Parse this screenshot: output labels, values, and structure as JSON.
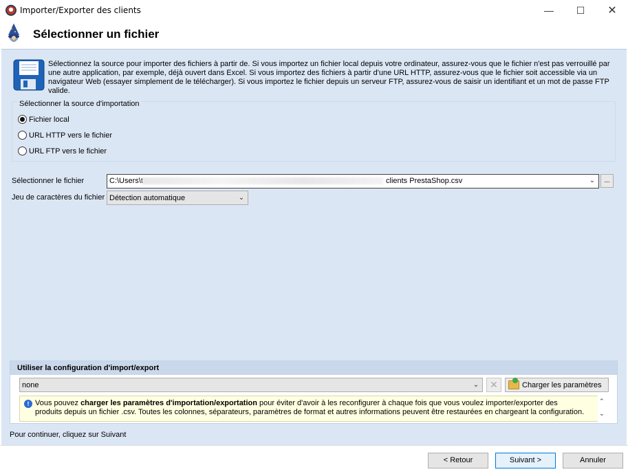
{
  "window": {
    "title": "Importer/Exporter des clients",
    "minimize": "—",
    "maximize": "☐",
    "close": "✕"
  },
  "header": {
    "title": "Sélectionner un fichier"
  },
  "intro": {
    "text": "Sélectionnez la source pour importer des fichiers à partir de. Si vous importez un fichier local depuis votre ordinateur, assurez-vous que le fichier n'est pas verrouillé par une autre application, par exemple, déjà ouvert dans Excel. Si vous importez des fichiers à partir d'une URL HTTP, assurez-vous que le fichier soit accessible via un navigateur Web (essayer simplement de le télécharger). Si vous importez le fichier depuis un serveur FTP, assurez-vous de saisir un identifiant et un mot de passe FTP valide."
  },
  "source": {
    "legend": "Sélectionner la source d'importation",
    "options": [
      {
        "label": "Fichier local",
        "checked": true
      },
      {
        "label": "URL HTTP vers le fichier",
        "checked": false
      },
      {
        "label": "URL FTP vers le fichier",
        "checked": false
      }
    ]
  },
  "file": {
    "label": "Sélectionner le fichier",
    "value_prefix": "C:\\Users\\t",
    "value_suffix": "clients PrestaShop.csv",
    "browse": "..."
  },
  "charset": {
    "label": "Jeu de caractères du fichier",
    "value": "Détection automatique"
  },
  "config": {
    "header": "Utiliser la configuration d'import/export",
    "value": "none",
    "load_label": "Charger les paramètres",
    "info_prefix": "Vous pouvez ",
    "info_bold": "charger les paramètres d'importation/exportation",
    "info_rest": " pour éviter d'avoir à les reconfigurer à chaque fois que vous voulez importer/exporter des produits depuis un fichier .csv. Toutes les colonnes, séparateurs, paramètres de format et autres informations peuvent être restaurées en chargeant la configuration."
  },
  "continue_text": "Pour continuer, cliquez sur Suivant",
  "buttons": {
    "back": "< Retour",
    "next": "Suivant >",
    "cancel": "Annuler"
  }
}
